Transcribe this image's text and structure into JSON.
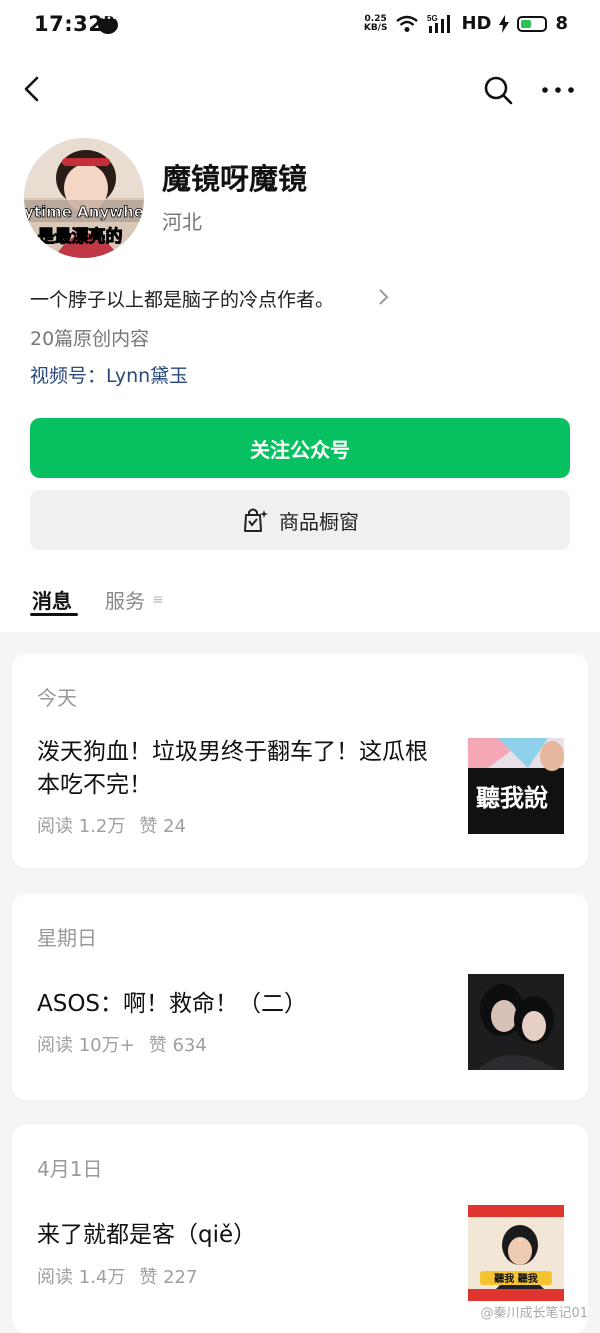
{
  "status_bar": {
    "time": "17:32",
    "net_speed_value": "0.25",
    "net_speed_unit": "KB/S",
    "network": "5G",
    "hd": "HD",
    "battery_level": "8"
  },
  "profile": {
    "name": "魔镜呀魔镜",
    "region": "河北",
    "bio": "一个脖子以上都是脑子的冷点作者。",
    "original_count": "20篇原创内容",
    "video_channel": "视频号：Lynn黛玉",
    "avatar_text_line1": "ytime Anywhe",
    "avatar_text_line2": "是最漂亮的"
  },
  "actions": {
    "follow": "关注公众号",
    "shop": "商品橱窗"
  },
  "tabs": {
    "messages": "消息",
    "services": "服务"
  },
  "articles": [
    {
      "date": "今天",
      "title": "泼天狗血！垃圾男终于翻车了！这瓜根本吃不完！",
      "reads": "阅读 1.2万",
      "likes": "赞 24",
      "thumb_text": "聽我說"
    },
    {
      "date": "星期日",
      "title": "ASOS：啊！救命！（二）",
      "reads": "阅读 10万+",
      "likes": "赞 634"
    },
    {
      "date": "4月1日",
      "title": "来了就都是客（qiě）",
      "reads": "阅读 1.4万",
      "likes": "赞 227",
      "thumb_text": "聽我 聽我"
    }
  ],
  "watermark": "@秦川成长笔记01",
  "colors": {
    "accent_green": "#07c160",
    "link_blue": "#2a4a7c"
  }
}
